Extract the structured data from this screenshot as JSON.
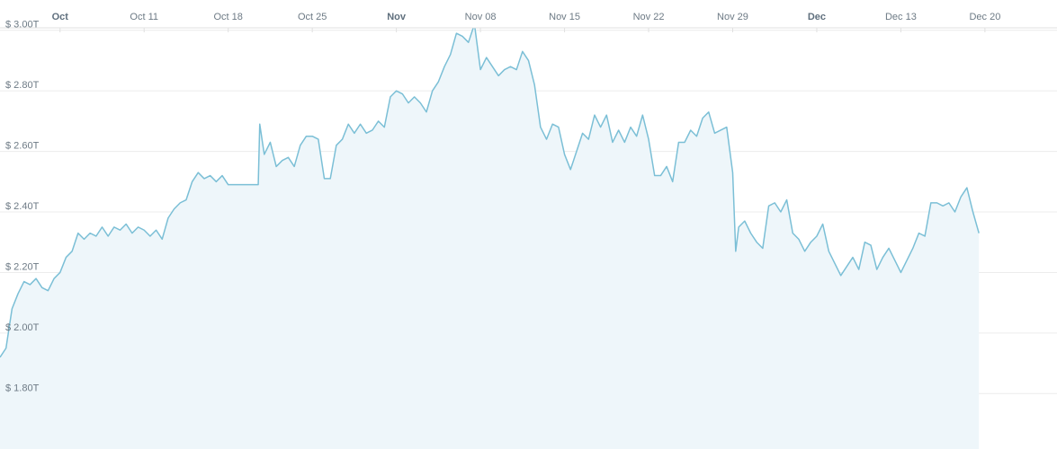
{
  "chart_data": {
    "type": "area",
    "title": "",
    "xlabel": "",
    "ylabel": "",
    "grid": true,
    "colors": {
      "line": "#7bbfd6",
      "fill": "#eef6fa",
      "grid": "#ececec",
      "axis": "#e0e0e0"
    },
    "x_ticks": [
      {
        "label": "Oct",
        "date": "2021-10-04",
        "major": true
      },
      {
        "label": "Oct 11",
        "date": "2021-10-11",
        "major": false
      },
      {
        "label": "Oct 18",
        "date": "2021-10-18",
        "major": false
      },
      {
        "label": "Oct 25",
        "date": "2021-10-25",
        "major": false
      },
      {
        "label": "Nov",
        "date": "2021-11-01",
        "major": true
      },
      {
        "label": "Nov 08",
        "date": "2021-11-08",
        "major": false
      },
      {
        "label": "Nov 15",
        "date": "2021-11-15",
        "major": false
      },
      {
        "label": "Nov 22",
        "date": "2021-11-22",
        "major": false
      },
      {
        "label": "Nov 29",
        "date": "2021-11-29",
        "major": false
      },
      {
        "label": "Dec",
        "date": "2021-12-06",
        "major": true
      },
      {
        "label": "Dec 13",
        "date": "2021-12-13",
        "major": false
      },
      {
        "label": "Dec 20",
        "date": "2021-12-20",
        "major": false
      }
    ],
    "y_ticks": [
      {
        "label": "$ 1.80T",
        "value": 1.8
      },
      {
        "label": "$ 2.00T",
        "value": 2.0
      },
      {
        "label": "$ 2.20T",
        "value": 2.2
      },
      {
        "label": "$ 2.40T",
        "value": 2.4
      },
      {
        "label": "$ 2.60T",
        "value": 2.6
      },
      {
        "label": "$ 2.80T",
        "value": 2.8
      },
      {
        "label": "$ 3.00T",
        "value": 3.0
      }
    ],
    "xlim": [
      "2021-09-29",
      "2021-12-26"
    ],
    "ylim": [
      1.617,
      3.1
    ],
    "series": [
      {
        "values": [
          [
            "2021-09-29",
            1.92
          ],
          [
            "2021-09-29T12:00",
            1.95
          ],
          [
            "2021-09-30",
            2.08
          ],
          [
            "2021-09-30T12:00",
            2.13
          ],
          [
            "2021-10-01",
            2.17
          ],
          [
            "2021-10-01T12:00",
            2.16
          ],
          [
            "2021-10-02",
            2.18
          ],
          [
            "2021-10-02T12:00",
            2.15
          ],
          [
            "2021-10-03",
            2.14
          ],
          [
            "2021-10-03T12:00",
            2.18
          ],
          [
            "2021-10-04",
            2.2
          ],
          [
            "2021-10-04T12:00",
            2.25
          ],
          [
            "2021-10-05",
            2.27
          ],
          [
            "2021-10-05T12:00",
            2.33
          ],
          [
            "2021-10-06",
            2.31
          ],
          [
            "2021-10-06T12:00",
            2.33
          ],
          [
            "2021-10-07",
            2.32
          ],
          [
            "2021-10-07T12:00",
            2.35
          ],
          [
            "2021-10-08",
            2.32
          ],
          [
            "2021-10-08T12:00",
            2.35
          ],
          [
            "2021-10-09",
            2.34
          ],
          [
            "2021-10-09T12:00",
            2.36
          ],
          [
            "2021-10-10",
            2.33
          ],
          [
            "2021-10-10T12:00",
            2.35
          ],
          [
            "2021-10-11",
            2.34
          ],
          [
            "2021-10-11T12:00",
            2.32
          ],
          [
            "2021-10-12",
            2.34
          ],
          [
            "2021-10-12T12:00",
            2.31
          ],
          [
            "2021-10-13",
            2.38
          ],
          [
            "2021-10-13T12:00",
            2.41
          ],
          [
            "2021-10-14",
            2.43
          ],
          [
            "2021-10-14T12:00",
            2.44
          ],
          [
            "2021-10-15",
            2.5
          ],
          [
            "2021-10-15T12:00",
            2.53
          ],
          [
            "2021-10-16",
            2.51
          ],
          [
            "2021-10-16T12:00",
            2.52
          ],
          [
            "2021-10-17",
            2.5
          ],
          [
            "2021-10-17T12:00",
            2.52
          ],
          [
            "2021-10-18",
            2.49
          ],
          [
            "2021-10-19",
            2.49
          ],
          [
            "2021-10-20",
            2.49
          ],
          [
            "2021-10-20T12:00",
            2.49
          ],
          [
            "2021-10-20T15:00",
            2.69
          ],
          [
            "2021-10-21",
            2.59
          ],
          [
            "2021-10-21T12:00",
            2.63
          ],
          [
            "2021-10-22",
            2.55
          ],
          [
            "2021-10-22T12:00",
            2.57
          ],
          [
            "2021-10-23",
            2.58
          ],
          [
            "2021-10-23T12:00",
            2.55
          ],
          [
            "2021-10-24",
            2.62
          ],
          [
            "2021-10-24T12:00",
            2.65
          ],
          [
            "2021-10-25",
            2.65
          ],
          [
            "2021-10-25T12:00",
            2.64
          ],
          [
            "2021-10-26",
            2.51
          ],
          [
            "2021-10-26T12:00",
            2.51
          ],
          [
            "2021-10-27",
            2.62
          ],
          [
            "2021-10-27T12:00",
            2.64
          ],
          [
            "2021-10-28",
            2.69
          ],
          [
            "2021-10-28T12:00",
            2.66
          ],
          [
            "2021-10-29",
            2.69
          ],
          [
            "2021-10-29T12:00",
            2.66
          ],
          [
            "2021-10-30",
            2.67
          ],
          [
            "2021-10-30T12:00",
            2.7
          ],
          [
            "2021-10-31",
            2.68
          ],
          [
            "2021-10-31T12:00",
            2.78
          ],
          [
            "2021-11-01",
            2.8
          ],
          [
            "2021-11-01T12:00",
            2.79
          ],
          [
            "2021-11-02",
            2.76
          ],
          [
            "2021-11-02T12:00",
            2.78
          ],
          [
            "2021-11-03",
            2.76
          ],
          [
            "2021-11-03T12:00",
            2.73
          ],
          [
            "2021-11-04",
            2.8
          ],
          [
            "2021-11-04T12:00",
            2.83
          ],
          [
            "2021-11-05",
            2.88
          ],
          [
            "2021-11-05T12:00",
            2.92
          ],
          [
            "2021-11-06",
            2.99
          ],
          [
            "2021-11-06T12:00",
            2.98
          ],
          [
            "2021-11-07",
            2.96
          ],
          [
            "2021-11-07T12:00",
            3.02
          ],
          [
            "2021-11-08",
            2.87
          ],
          [
            "2021-11-08T12:00",
            2.91
          ],
          [
            "2021-11-09",
            2.88
          ],
          [
            "2021-11-09T12:00",
            2.85
          ],
          [
            "2021-11-10",
            2.87
          ],
          [
            "2021-11-10T12:00",
            2.88
          ],
          [
            "2021-11-11",
            2.87
          ],
          [
            "2021-11-11T12:00",
            2.93
          ],
          [
            "2021-11-12",
            2.9
          ],
          [
            "2021-11-12T12:00",
            2.82
          ],
          [
            "2021-11-13",
            2.68
          ],
          [
            "2021-11-13T12:00",
            2.64
          ],
          [
            "2021-11-14",
            2.69
          ],
          [
            "2021-11-14T12:00",
            2.68
          ],
          [
            "2021-11-15",
            2.59
          ],
          [
            "2021-11-15T12:00",
            2.54
          ],
          [
            "2021-11-16",
            2.6
          ],
          [
            "2021-11-16T12:00",
            2.66
          ],
          [
            "2021-11-17",
            2.64
          ],
          [
            "2021-11-17T12:00",
            2.72
          ],
          [
            "2021-11-18",
            2.68
          ],
          [
            "2021-11-18T12:00",
            2.72
          ],
          [
            "2021-11-19",
            2.63
          ],
          [
            "2021-11-19T12:00",
            2.67
          ],
          [
            "2021-11-20",
            2.63
          ],
          [
            "2021-11-20T12:00",
            2.68
          ],
          [
            "2021-11-21",
            2.65
          ],
          [
            "2021-11-21T12:00",
            2.72
          ],
          [
            "2021-11-22",
            2.64
          ],
          [
            "2021-11-22T12:00",
            2.52
          ],
          [
            "2021-11-23",
            2.52
          ],
          [
            "2021-11-23T12:00",
            2.55
          ],
          [
            "2021-11-24",
            2.5
          ],
          [
            "2021-11-24T12:00",
            2.63
          ],
          [
            "2021-11-25",
            2.63
          ],
          [
            "2021-11-25T12:00",
            2.67
          ],
          [
            "2021-11-26",
            2.65
          ],
          [
            "2021-11-26T12:00",
            2.71
          ],
          [
            "2021-11-27",
            2.73
          ],
          [
            "2021-11-27T12:00",
            2.66
          ],
          [
            "2021-11-28",
            2.67
          ],
          [
            "2021-11-28T12:00",
            2.68
          ],
          [
            "2021-11-29",
            2.53
          ],
          [
            "2021-11-29T06:00",
            2.27
          ],
          [
            "2021-11-29T12:00",
            2.35
          ],
          [
            "2021-11-30",
            2.37
          ],
          [
            "2021-11-30T12:00",
            2.33
          ],
          [
            "2021-12-01",
            2.3
          ],
          [
            "2021-12-01T12:00",
            2.28
          ],
          [
            "2021-12-02",
            2.42
          ],
          [
            "2021-12-02T12:00",
            2.43
          ],
          [
            "2021-12-03",
            2.4
          ],
          [
            "2021-12-03T12:00",
            2.44
          ],
          [
            "2021-12-04",
            2.33
          ],
          [
            "2021-12-04T12:00",
            2.31
          ],
          [
            "2021-12-05",
            2.27
          ],
          [
            "2021-12-05T12:00",
            2.3
          ],
          [
            "2021-12-06",
            2.32
          ],
          [
            "2021-12-06T12:00",
            2.36
          ],
          [
            "2021-12-07",
            2.27
          ],
          [
            "2021-12-07T12:00",
            2.23
          ],
          [
            "2021-12-08",
            2.19
          ],
          [
            "2021-12-08T12:00",
            2.22
          ],
          [
            "2021-12-09",
            2.25
          ],
          [
            "2021-12-09T12:00",
            2.21
          ],
          [
            "2021-12-10",
            2.3
          ],
          [
            "2021-12-10T12:00",
            2.29
          ],
          [
            "2021-12-11",
            2.21
          ],
          [
            "2021-12-11T12:00",
            2.25
          ],
          [
            "2021-12-12",
            2.28
          ],
          [
            "2021-12-12T12:00",
            2.24
          ],
          [
            "2021-12-13",
            2.2
          ],
          [
            "2021-12-13T12:00",
            2.24
          ],
          [
            "2021-12-14",
            2.28
          ],
          [
            "2021-12-14T12:00",
            2.33
          ],
          [
            "2021-12-15",
            2.32
          ],
          [
            "2021-12-15T12:00",
            2.43
          ],
          [
            "2021-12-16",
            2.43
          ],
          [
            "2021-12-16T12:00",
            2.42
          ],
          [
            "2021-12-17",
            2.43
          ],
          [
            "2021-12-17T12:00",
            2.4
          ],
          [
            "2021-12-18",
            2.45
          ],
          [
            "2021-12-18T12:00",
            2.48
          ],
          [
            "2021-12-19",
            2.4
          ],
          [
            "2021-12-19T12:00",
            2.33
          ]
        ]
      }
    ]
  }
}
